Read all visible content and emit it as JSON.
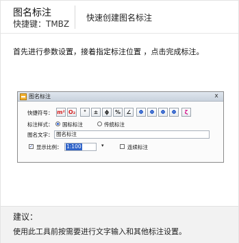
{
  "header": {
    "title": "图名标注",
    "shortcut": "快捷键：TMBZ",
    "description": "快速创建图名标注"
  },
  "instruction": "首先进行参数设置，接着指定标注位置 ，点击完成标注。",
  "dialog": {
    "title": "图名标注",
    "close": "x",
    "shortcut_symbol_label": "快捷符号：",
    "symbols": [
      "m²",
      "O₂",
      "°",
      "±",
      "ϕ",
      "%",
      "∠",
      "Φ",
      "Φ",
      "Φ",
      "Φ",
      "ζ"
    ],
    "style_label": "标注样式：",
    "style_options": [
      "国标标注",
      "传统标注"
    ],
    "style_selected": "国标标注",
    "text_label": "图名文字：",
    "text_value": "图名标注",
    "show_scale_label": "显示比例：",
    "show_scale_checked": true,
    "scale_value": "1:100",
    "continuous_label": "连续标注",
    "continuous_checked": false
  },
  "footer": {
    "title": "建议：",
    "text": "使用此工具前按需要进行文字输入和其他标注设置。"
  }
}
